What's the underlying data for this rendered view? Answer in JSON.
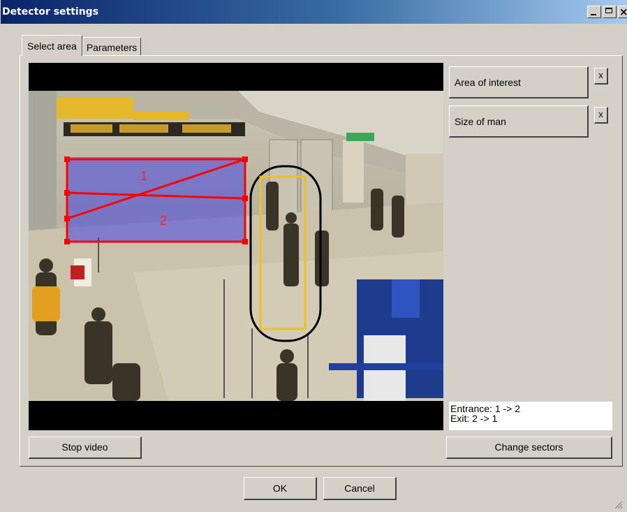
{
  "window": {
    "title": "Detector settings",
    "close_glyph": "×"
  },
  "tabs": [
    {
      "label": "Select area",
      "active": true
    },
    {
      "label": "Parameters",
      "active": false
    }
  ],
  "video": {
    "sector_labels": [
      "1",
      "2"
    ],
    "icons": [
      "video-preview",
      "polygon-zone",
      "person-size-marker"
    ]
  },
  "zones": [
    {
      "label": "Area of interest",
      "remove_label": "x"
    },
    {
      "label": "Size of man",
      "remove_label": "x"
    }
  ],
  "info": {
    "entrance": "Entrance: 1 -> 2",
    "exit": "Exit: 2 -> 1"
  },
  "buttons": {
    "stop_video": "Stop video",
    "change_sectors": "Change sectors",
    "ok": "OK",
    "cancel": "Cancel"
  },
  "colors": {
    "zone_stroke": "#ff0000",
    "zone_fill": "#2a2af0",
    "size_marker": "#f0c020",
    "size_outline": "#000000",
    "title_start": "#0a246a",
    "title_end": "#a6caf0",
    "dialog_bg": "#d4d0c8"
  }
}
